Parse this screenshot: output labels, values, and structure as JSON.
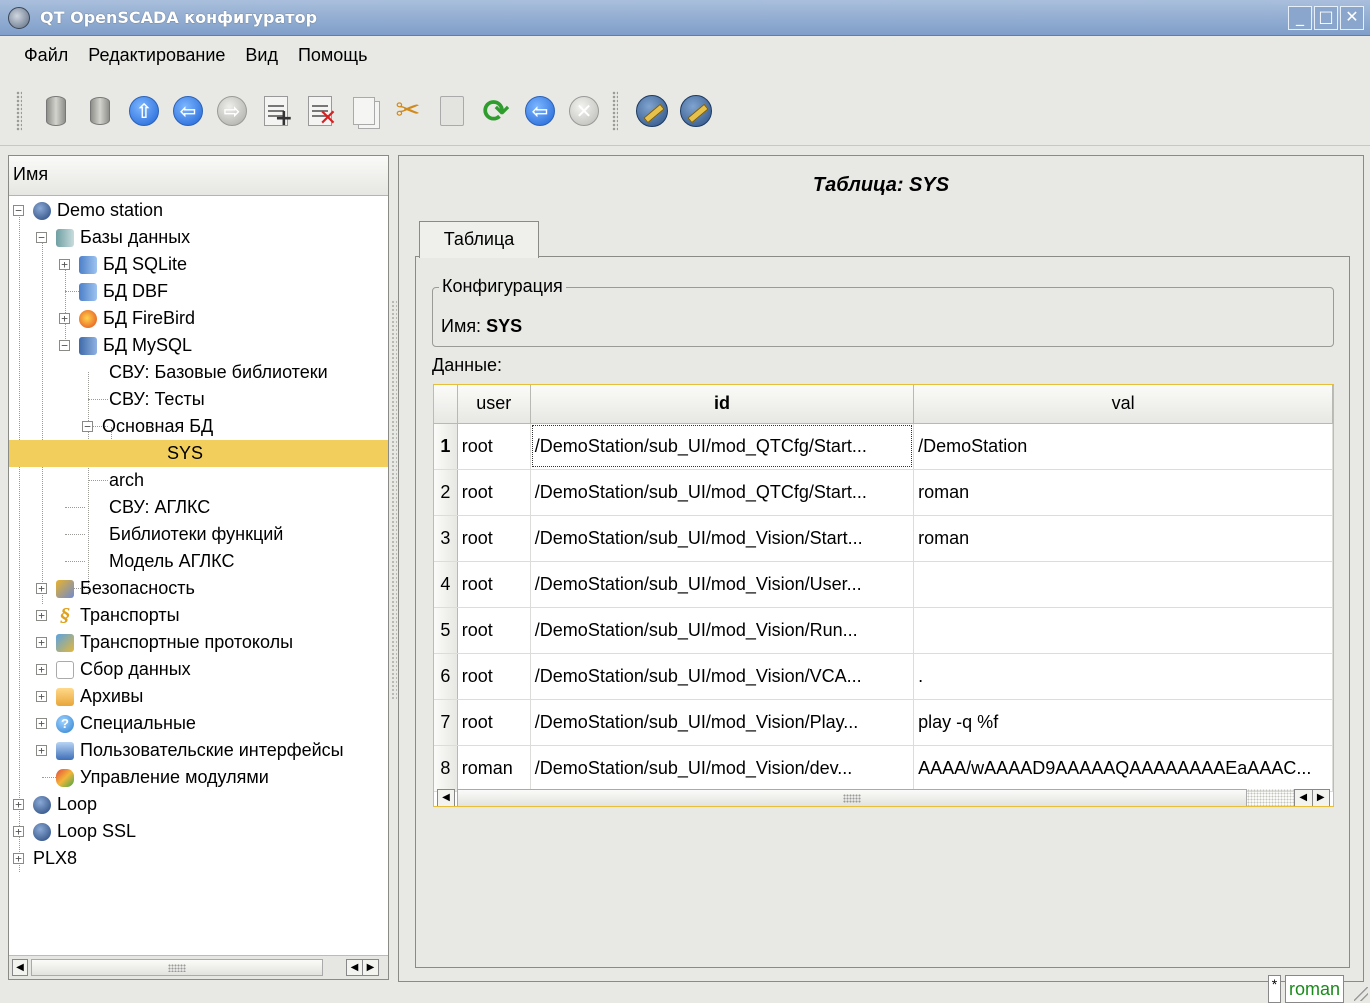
{
  "window": {
    "title": "QT OpenSCADA конфигуратор"
  },
  "menu": [
    {
      "label": "Файл"
    },
    {
      "label": "Редактирование"
    },
    {
      "label": "Вид"
    },
    {
      "label": "Помощь"
    }
  ],
  "toolbar": {
    "items": [
      {
        "icon": "db-load-icon"
      },
      {
        "icon": "db-save-icon"
      },
      {
        "icon": "up-icon",
        "glyph": "⇧"
      },
      {
        "icon": "back-icon",
        "glyph": "⇦"
      },
      {
        "icon": "forward-icon",
        "glyph": "⇨"
      },
      {
        "icon": "add-item-icon",
        "glyph": "+"
      },
      {
        "icon": "delete-item-icon",
        "glyph": "✕"
      },
      {
        "icon": "copy-icon"
      },
      {
        "icon": "cut-icon",
        "glyph": "✂"
      },
      {
        "icon": "paste-icon"
      },
      {
        "icon": "reload-icon",
        "glyph": "⟳"
      },
      {
        "icon": "start-icon",
        "glyph": "⇦"
      },
      {
        "icon": "stop-icon",
        "glyph": "✕"
      },
      {
        "icon": "tool-1-icon"
      },
      {
        "icon": "tool-2-icon"
      }
    ]
  },
  "tree": {
    "header": "Имя",
    "nodes": [
      {
        "label": "Demo station",
        "icon": "station-icon"
      },
      {
        "label": "Базы данных",
        "icon": "databases-icon"
      },
      {
        "label": "БД SQLite",
        "icon": "db-icon"
      },
      {
        "label": "БД DBF",
        "icon": "db-icon"
      },
      {
        "label": "БД FireBird",
        "icon": "firebird-icon"
      },
      {
        "label": "БД MySQL",
        "icon": "mysql-icon"
      },
      {
        "label": "СВУ: Базовые библиотеки"
      },
      {
        "label": "СВУ: Тесты"
      },
      {
        "label": "Основная БД"
      },
      {
        "label": "SYS"
      },
      {
        "label": "arch"
      },
      {
        "label": "СВУ: АГЛКС"
      },
      {
        "label": "Библиотеки функций"
      },
      {
        "label": "Модель АГЛКС"
      },
      {
        "label": "Безопасность",
        "icon": "security-icon"
      },
      {
        "label": "Транспорты",
        "icon": "transports-icon",
        "glyph": "§"
      },
      {
        "label": "Транспортные протоколы",
        "icon": "protocols-icon"
      },
      {
        "label": "Сбор данных",
        "icon": "daq-icon"
      },
      {
        "label": "Архивы",
        "icon": "archives-icon"
      },
      {
        "label": "Специальные",
        "icon": "special-icon",
        "glyph": "?"
      },
      {
        "label": "Пользовательские интерфейсы",
        "icon": "ui-icon"
      },
      {
        "label": "Управление модулями",
        "icon": "modules-icon"
      },
      {
        "label": "Loop",
        "icon": "station-icon"
      },
      {
        "label": "Loop SSL",
        "icon": "station-icon"
      },
      {
        "label": "PLX8"
      }
    ]
  },
  "main": {
    "title": "Таблица: SYS",
    "tab": "Таблица",
    "config": {
      "legend": "Конфигурация",
      "name_label": "Имя:",
      "name_value": "SYS"
    },
    "data_label": "Данные:",
    "table": {
      "columns": [
        "user",
        "id",
        "val"
      ],
      "rows": [
        {
          "n": "1",
          "user": "root",
          "id": "/DemoStation/sub_UI/mod_QTCfg/Start...",
          "val": "/DemoStation"
        },
        {
          "n": "2",
          "user": "root",
          "id": "/DemoStation/sub_UI/mod_QTCfg/Start...",
          "val": "roman"
        },
        {
          "n": "3",
          "user": "root",
          "id": "/DemoStation/sub_UI/mod_Vision/Start...",
          "val": "roman"
        },
        {
          "n": "4",
          "user": "root",
          "id": "/DemoStation/sub_UI/mod_Vision/User...",
          "val": ""
        },
        {
          "n": "5",
          "user": "root",
          "id": "/DemoStation/sub_UI/mod_Vision/Run...",
          "val": ""
        },
        {
          "n": "6",
          "user": "root",
          "id": "/DemoStation/sub_UI/mod_Vision/VCA...",
          "val": "."
        },
        {
          "n": "7",
          "user": "root",
          "id": "/DemoStation/sub_UI/mod_Vision/Play...",
          "val": "play -q %f"
        },
        {
          "n": "8",
          "user": "roman",
          "id": "/DemoStation/sub_UI/mod_Vision/dev...",
          "val": "AAAA/wAAAAD9AAAAAQAAAAAAAAEaAAAC..."
        }
      ]
    }
  },
  "status": {
    "modified": "*",
    "user": "roman"
  }
}
